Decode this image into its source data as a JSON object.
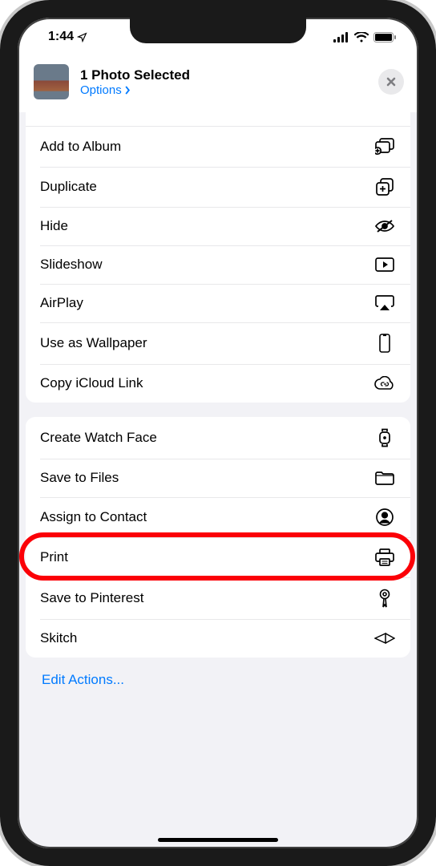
{
  "status": {
    "time": "1:44",
    "signal_label": "cellular-signal-icon",
    "wifi_label": "wifi-icon",
    "battery_label": "battery-icon"
  },
  "header": {
    "title": "1 Photo Selected",
    "options_label": "Options",
    "close_label": "Close"
  },
  "groups": [
    {
      "items": [
        {
          "label": "Add to Album",
          "icon": "add-to-album-icon"
        },
        {
          "label": "Duplicate",
          "icon": "duplicate-icon"
        },
        {
          "label": "Hide",
          "icon": "hide-icon"
        },
        {
          "label": "Slideshow",
          "icon": "slideshow-icon"
        },
        {
          "label": "AirPlay",
          "icon": "airplay-icon"
        },
        {
          "label": "Use as Wallpaper",
          "icon": "wallpaper-icon"
        },
        {
          "label": "Copy iCloud Link",
          "icon": "icloud-link-icon"
        }
      ]
    },
    {
      "items": [
        {
          "label": "Create Watch Face",
          "icon": "watch-icon"
        },
        {
          "label": "Save to Files",
          "icon": "folder-icon"
        },
        {
          "label": "Assign to Contact",
          "icon": "contact-icon"
        },
        {
          "label": "Print",
          "icon": "print-icon",
          "highlighted": true
        },
        {
          "label": "Save to Pinterest",
          "icon": "pinterest-icon"
        },
        {
          "label": "Skitch",
          "icon": "skitch-icon"
        }
      ]
    }
  ],
  "edit_actions_label": "Edit Actions...",
  "highlight": {
    "target": "Print"
  }
}
